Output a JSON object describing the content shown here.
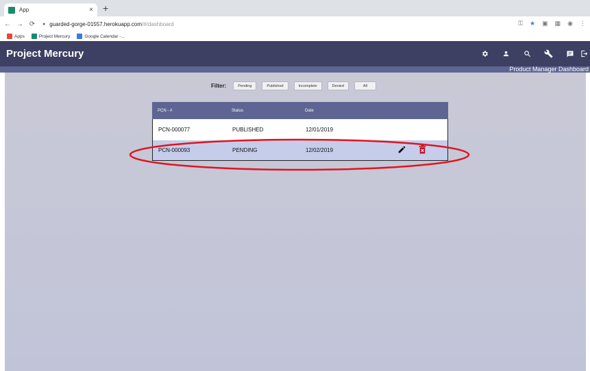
{
  "browser": {
    "tab_title": "App",
    "tab_close": "×",
    "new_tab": "+",
    "url_host": "guarded-gorge-01557.herokuapp.com",
    "url_path": "/#/dashboard",
    "bookmarks": [
      {
        "label": "Apps",
        "color": "#e8453c"
      },
      {
        "label": "Project Mercury",
        "color": "#1a8a6e"
      },
      {
        "label": "Google Calendar -...",
        "color": "#3b78e7"
      }
    ]
  },
  "app": {
    "brand": "Project Mercury",
    "dashboard_title": "Product Manager Dashboard",
    "header_icons": [
      "settings-icon",
      "user-icon",
      "search-icon",
      "wrench-icon",
      "chat-icon",
      "logout-icon"
    ]
  },
  "filter": {
    "label": "Filter:",
    "buttons": [
      "Pending",
      "Published",
      "Incomplete",
      "Denied",
      "All"
    ]
  },
  "table": {
    "headers": [
      "PCN - #",
      "Status",
      "Date"
    ],
    "rows": [
      {
        "pcn": "PCN-000077",
        "status": "PUBLISHED",
        "date": "12/01/2019"
      },
      {
        "pcn": "PCN-000093",
        "status": "PENDING",
        "date": "12/02/2019"
      }
    ]
  },
  "colors": {
    "header_bg": "#3d3f63",
    "table_header_bg": "#5e6592",
    "pending_row_bg": "#c6cdeb",
    "delete_icon": "#c0142a",
    "annotation": "#e0141e"
  }
}
